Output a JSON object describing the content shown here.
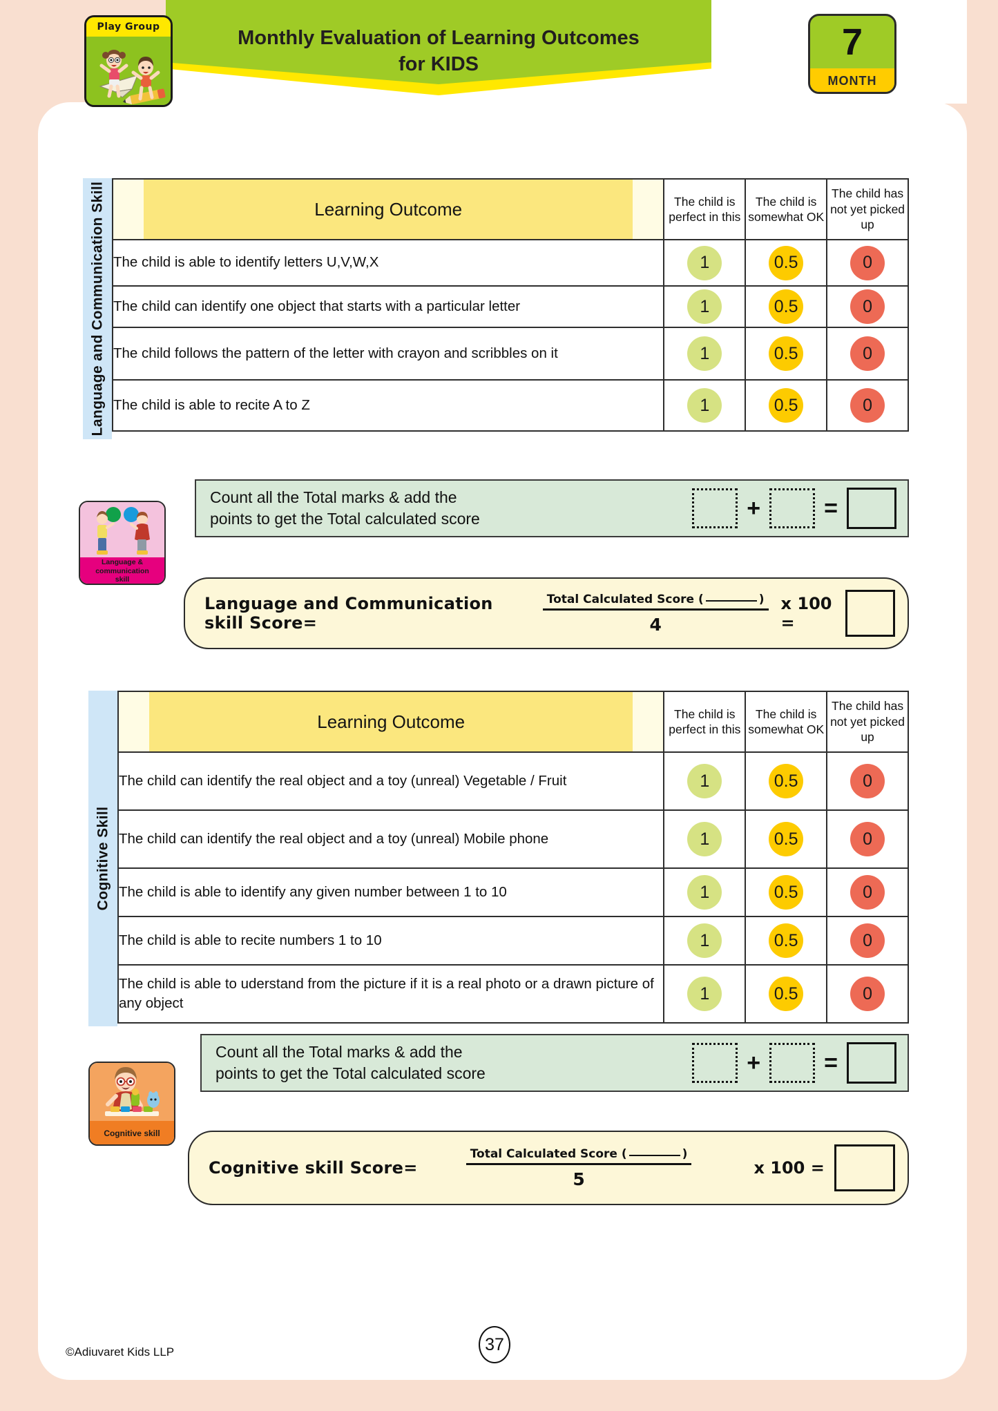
{
  "header": {
    "playgroup_label": "Play Group",
    "title_line1": "Monthly Evaluation of Learning Outcomes",
    "title_line2": "for KIDS",
    "month_number": "7",
    "month_label": "MONTH"
  },
  "columns": {
    "outcome": "Learning Outcome",
    "perfect": "The child is perfect in this",
    "somewhat": "The child is somewhat OK",
    "notyet": "The child has not yet picked up"
  },
  "marks": {
    "one": "1",
    "half": "0.5",
    "zero": "0"
  },
  "sections": [
    {
      "side_label": "Language and Communication Skill",
      "rows": [
        "The child is able to identify letters U,V,W,X",
        "The child can identify one object that starts with a particular letter",
        "The child follows the pattern of the letter with crayon and scribbles on it",
        "The child is able to recite A to Z"
      ],
      "total_strip": {
        "line1": "Count all the Total marks & add the",
        "line2": "points to get the Total calculated score",
        "plus": "+",
        "equals": "="
      },
      "icon_card": {
        "label_line1": "Language &",
        "label_line2": "communication",
        "label_line3": "skill"
      },
      "formula": {
        "label": "Language and Communication skill Score=",
        "numerator_prefix": "Total Calculated Score (",
        "numerator_suffix": ")",
        "denominator": "4",
        "multiplier": "x 100 ="
      }
    },
    {
      "side_label": "Cognitive Skill",
      "rows": [
        "The child can identify the real object and a toy (unreal) Vegetable / Fruit",
        "The child can identify the real object and a toy (unreal) Mobile phone",
        "The child is able to identify any given number  between 1 to 10",
        "The child is able to recite numbers  1 to 10",
        "The child is able to uderstand from the picture if it is a real photo or a drawn picture of any object"
      ],
      "total_strip": {
        "line1": "Count all the Total marks & add the",
        "line2": "points to get the Total calculated score",
        "plus": "+",
        "equals": "="
      },
      "icon_card": {
        "label_line1": "Cognitive skill",
        "label_line2": "",
        "label_line3": ""
      },
      "formula": {
        "label": "Cognitive skill Score=",
        "numerator_prefix": "Total Calculated Score (",
        "numerator_suffix": ")",
        "denominator": "5",
        "multiplier": "x 100 ="
      }
    }
  ],
  "footer": {
    "copyright": "©Adiuvaret Kids LLP",
    "page_number": "37"
  },
  "colors": {
    "page_bg": "#f9dfd0",
    "banner_green": "#9fcb26",
    "banner_yellow": "#ffe800",
    "side_tab": "#cfe6f7",
    "mark_one": "#d6e283",
    "mark_half": "#fdcb00",
    "mark_zero": "#ed6a55",
    "total_strip": "#d8e9d8",
    "formula_bg": "#fdf7d8",
    "lang_icon": "#e6007e",
    "cog_icon": "#f07d23"
  }
}
